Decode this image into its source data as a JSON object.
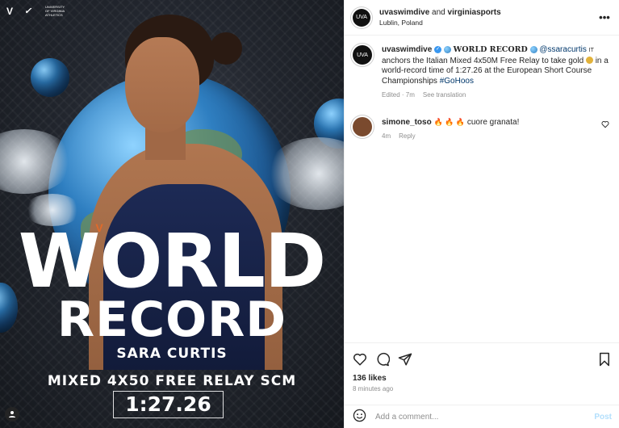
{
  "media": {
    "headline_1": "WORLD",
    "headline_2": "RECORD",
    "athlete_name": "SARA CURTIS",
    "event": "MIXED 4X50 FREE RELAY SCM",
    "time": "1:27.26",
    "logo_text": "UNIVERSITY OF VIRGINIA ATHLETICS",
    "uva_mark": "V",
    "nike_mark": "✓",
    "tag_icon": "user-icon"
  },
  "header": {
    "avatar_text": "UVA",
    "account_primary": "uvaswimdive",
    "connector": " and ",
    "account_secondary": "virginiasports",
    "location": "Lublin, Poland",
    "more_icon": "•••"
  },
  "caption": {
    "username": "uvaswimdive",
    "verified_icon": "✓",
    "title": "WORLD RECORD",
    "mention": "@ssaracurtis",
    "flag_code": "IT",
    "text_1": " anchors the Italian Mixed 4x50M Free Relay to take gold ",
    "text_2": " in a world-record time of 1:27.26 at the European Short Course Championships ",
    "hashtag": "#GoHoos",
    "edited": "Edited · 7m",
    "see_translation": "See translation"
  },
  "comments": [
    {
      "username": "simone_toso",
      "emojis": "🔥 🔥 🔥",
      "text": " cuore granata!",
      "age": "4m",
      "reply": "Reply"
    }
  ],
  "actions": {
    "likes": "136 likes",
    "time_ago": "8 minutes ago"
  },
  "composer": {
    "placeholder": "Add a comment...",
    "post_label": "Post"
  }
}
